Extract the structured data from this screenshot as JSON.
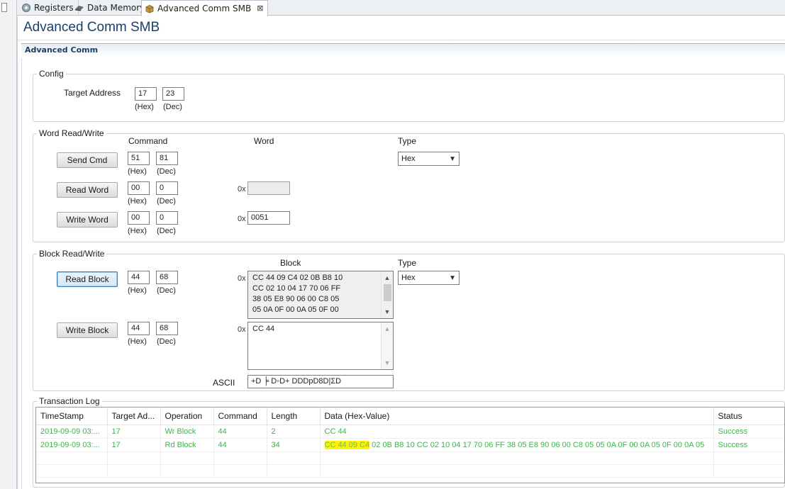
{
  "tabs": [
    {
      "label": "Registers",
      "icon": "gear-icon"
    },
    {
      "label": "Data Memory",
      "icon": "memory-chip-icon"
    },
    {
      "label": "Advanced Comm SMB",
      "icon": "package-icon",
      "active": true,
      "close": "⊠"
    }
  ],
  "page_title": "Advanced Comm SMB",
  "section_title": "Advanced Comm",
  "config": {
    "group_label": "Config",
    "target_address_label": "Target Address",
    "hex_value": "17",
    "dec_value": "23",
    "hex_label": "(Hex)",
    "dec_label": "(Dec)"
  },
  "word_rw": {
    "group_label": "Word Read/Write",
    "command_header": "Command",
    "word_header": "Word",
    "type_header": "Type",
    "type_value": "Hex",
    "hex_label": "(Hex)",
    "dec_label": "(Dec)",
    "prefix": "0x",
    "send": {
      "label": "Send Cmd",
      "hex": "51",
      "dec": "81"
    },
    "read": {
      "label": "Read Word",
      "hex": "00",
      "dec": "0",
      "word": ""
    },
    "write": {
      "label": "Write Word",
      "hex": "00",
      "dec": "0",
      "word": "0051"
    }
  },
  "block_rw": {
    "group_label": "Block Read/Write",
    "block_header": "Block",
    "type_header": "Type",
    "type_value": "Hex",
    "hex_label": "(Hex)",
    "dec_label": "(Dec)",
    "prefix": "0x",
    "read": {
      "label": "Read Block",
      "hex": "44",
      "dec": "68",
      "lines": [
        "CC 44 09 C4 02 0B B8 10",
        "CC 02 10 04 17 70 06 FF",
        "38 05 E8 90 06 00 C8 05",
        "05 0A 0F 00 0A 05 0F 00"
      ]
    },
    "write": {
      "label": "Write Block",
      "hex": "44",
      "dec": "68",
      "text": "CC 44"
    },
    "ascii_label": "ASCII",
    "ascii_value": "+D          ╞  D◦D+  DDDpD8D|ΣD"
  },
  "log": {
    "group_label": "Transaction Log",
    "columns": [
      "TimeStamp",
      "Target Ad...",
      "Operation",
      "Command",
      "Length",
      "Data (Hex-Value)",
      "Status"
    ],
    "rows": [
      {
        "timestamp": "2019-09-09 03:...",
        "target": "17",
        "operation": "Wr Block",
        "command": "44",
        "length": "2",
        "data_highlight": "",
        "data": "CC 44",
        "status": "Success"
      },
      {
        "timestamp": "2019-09-09 03:...",
        "target": "17",
        "operation": "Rd Block",
        "command": "44",
        "length": "34",
        "data_highlight": "CC 44 09 C4",
        "data": " 02 0B B8 10 CC 02 10 04 17 70 06 FF 38 05 E8 90 06 00 C8 05 05 0A 0F 00 0A 05 0F 00 0A 05",
        "status": "Success"
      }
    ],
    "text_color": "#3fb34f",
    "highlight_color": "#fff100"
  }
}
